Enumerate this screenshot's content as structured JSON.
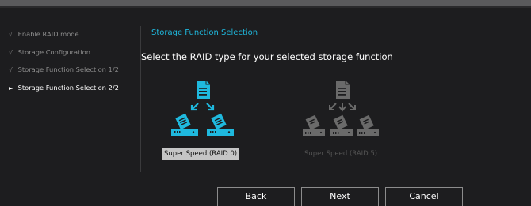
{
  "sidebar": {
    "steps": [
      {
        "mark": "√",
        "label": "Enable RAID mode"
      },
      {
        "mark": "√",
        "label": "Storage Configuration"
      },
      {
        "mark": "√",
        "label": "Storage Function Selection 1/2"
      },
      {
        "mark": "►",
        "label": "Storage Function Selection 2/2"
      }
    ]
  },
  "main": {
    "section_title": "Storage Function Selection",
    "prompt": "Select the RAID type for your selected storage function",
    "options": [
      {
        "label": "Super Speed (RAID 0)",
        "selected": true,
        "icon": "raid0-diagram-icon"
      },
      {
        "label": "Super Speed (RAID 5)",
        "selected": false,
        "icon": "raid5-diagram-icon"
      }
    ]
  },
  "buttons": {
    "back": "Back",
    "next": "Next",
    "cancel": "Cancel"
  },
  "colors": {
    "accent": "#1fb9de",
    "disabled": "#6a6a6a",
    "selected_bg": "#c5c5c5"
  }
}
